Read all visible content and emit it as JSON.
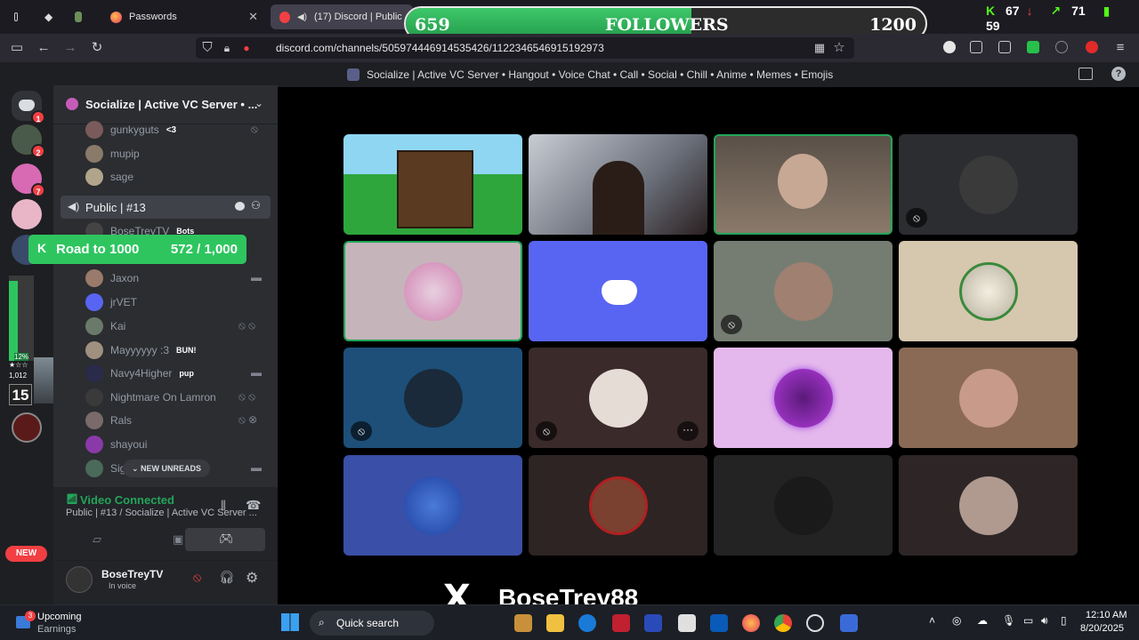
{
  "browser": {
    "tabs": [
      {
        "label": "",
        "icon": "sidebar-icon"
      },
      {
        "label": "",
        "icon": "shield-icon"
      },
      {
        "label": "",
        "icon": "badge-icon"
      },
      {
        "label": "Passwords",
        "icon": "firefox-icon"
      },
      {
        "label": "(17) Discord | Public | #13",
        "icon": "discord-icon",
        "active": true
      }
    ],
    "url": "discord.com/channels/505974446914535426/1122346546915192973"
  },
  "overlay": {
    "followers": {
      "current": "659",
      "label": "FOLLOWERS",
      "goal": "1200",
      "progress": 0.549
    },
    "stats": {
      "kick": "67",
      "up": "71",
      "bars": "59"
    },
    "road": {
      "label": "Road to 1000",
      "count": "572 / 1,000",
      "progress": 0.572
    },
    "watermark": "BoseTrey88",
    "rank_badge": "15",
    "rank_small": "1,012",
    "meter_percent": "12%"
  },
  "server": {
    "name": "Socialize | Active VC Server • ...",
    "full_title": "Socialize | Active VC Server • Hangout • Voice Chat • Call • Social • Chill • Anime • Memes • Emojis"
  },
  "rail": {
    "badges": [
      "1",
      "2",
      "7"
    ],
    "new_label": "NEW"
  },
  "members_top": [
    {
      "name": "gunkyguts",
      "tag": "<3"
    },
    {
      "name": "mupip",
      "tag": ""
    },
    {
      "name": "sage",
      "tag": ""
    }
  ],
  "channel": {
    "name": "Public | #13"
  },
  "members": [
    {
      "name": "BoseTreyTV",
      "tag": "Bots"
    },
    {
      "name": "Jaxon",
      "tag": ""
    },
    {
      "name": "jrVET",
      "tag": ""
    },
    {
      "name": "Kai",
      "tag": ""
    },
    {
      "name": "Mayyyyyy :3",
      "tag": "BUN!"
    },
    {
      "name": "Navy4Higher",
      "tag": "pup"
    },
    {
      "name": "Nightmare On Lamron",
      "tag": ""
    },
    {
      "name": "Rals",
      "tag": ""
    },
    {
      "name": "shayoui",
      "tag": ""
    },
    {
      "name": "Sig",
      "tag": ""
    }
  ],
  "new_unreads": "NEW UNREADS",
  "voice": {
    "status": "Video Connected",
    "location": "Public | #13 / Socialize | Active VC Server ..."
  },
  "user": {
    "name": "BoseTreyTV",
    "status": "In voice"
  },
  "taskbar": {
    "news_title": "Upcoming",
    "news_sub": "Earnings",
    "news_badge": "3",
    "search_placeholder": "Quick search",
    "time": "12:10 AM",
    "date": "8/20/2025"
  },
  "colors": {
    "accent_green": "#23a55a",
    "discord_blurple": "#5865f2",
    "danger": "#f23f43"
  }
}
